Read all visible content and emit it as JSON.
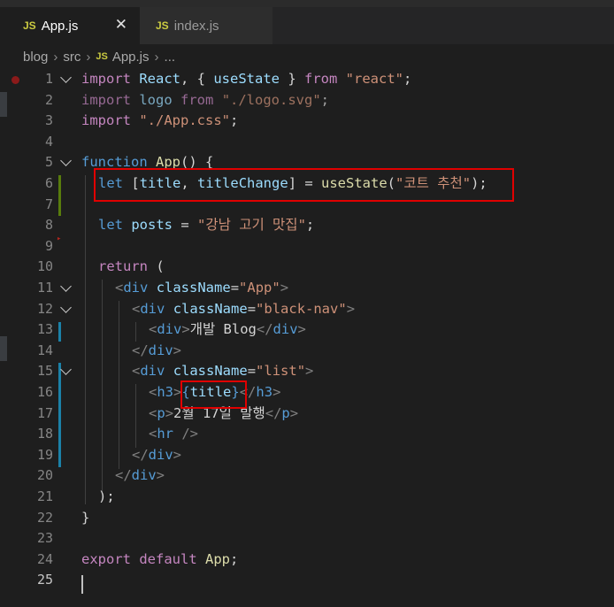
{
  "tabs": [
    {
      "icon": "JS",
      "label": "App.js",
      "active": true,
      "close": "✕"
    },
    {
      "icon": "JS",
      "label": "index.js",
      "active": false
    }
  ],
  "breadcrumb": [
    "blog",
    "src",
    "App.js",
    "..."
  ],
  "breadcrumb_icon": "JS",
  "line_numbers": [
    "1",
    "2",
    "3",
    "4",
    "5",
    "6",
    "7",
    "8",
    "9",
    "10",
    "11",
    "12",
    "13",
    "14",
    "15",
    "16",
    "17",
    "18",
    "19",
    "20",
    "21",
    "22",
    "23",
    "24",
    "25"
  ],
  "tokens": {
    "l1": [
      "import",
      "React",
      ", { ",
      "useState",
      " } ",
      "from",
      "\"react\"",
      ";"
    ],
    "l2": [
      "import",
      "logo",
      "from",
      "\"./logo.svg\"",
      ";"
    ],
    "l3": [
      "import",
      "\"./App.css\"",
      ";"
    ],
    "l5": [
      "function",
      "App",
      "() {"
    ],
    "l6": [
      "let",
      "[",
      "title",
      ", ",
      "titleChange",
      "] = ",
      "useState",
      "(",
      "\"코트 추천\"",
      ");"
    ],
    "l8": [
      "let",
      "posts",
      " = ",
      "\"강남 고기 맛집\"",
      ";"
    ],
    "l10": [
      "return",
      " ("
    ],
    "l11": [
      "<",
      "div",
      "className",
      "=",
      "\"App\"",
      ">"
    ],
    "l12": [
      "<",
      "div",
      "className",
      "=",
      "\"black-nav\"",
      ">"
    ],
    "l13": [
      "<",
      "div",
      ">",
      "개발 Blog",
      "</",
      "div",
      ">"
    ],
    "l14": [
      "</",
      "div",
      ">"
    ],
    "l15": [
      "<",
      "div",
      "className",
      "=",
      "\"list\"",
      ">"
    ],
    "l16": [
      "<",
      "h3",
      ">",
      "{",
      "title",
      "}",
      "</",
      "h3",
      ">"
    ],
    "l17": [
      "<",
      "p",
      ">",
      "2월 17일 발행",
      "</",
      "p",
      ">"
    ],
    "l18": [
      "<",
      "hr",
      " />"
    ],
    "l19": [
      "</",
      "div",
      ">"
    ],
    "l20": [
      "</",
      "div",
      ">"
    ],
    "l21": [
      ");"
    ],
    "l22": [
      "}"
    ],
    "l24": [
      "export",
      "default",
      "App",
      ";"
    ]
  },
  "colors": {
    "background": "#1e1e1e",
    "keyword": "#569cd6",
    "control": "#c586c0",
    "variable": "#9cdcfe",
    "function": "#dcdcaa",
    "string": "#ce9178",
    "highlight_box": "#e00000"
  }
}
